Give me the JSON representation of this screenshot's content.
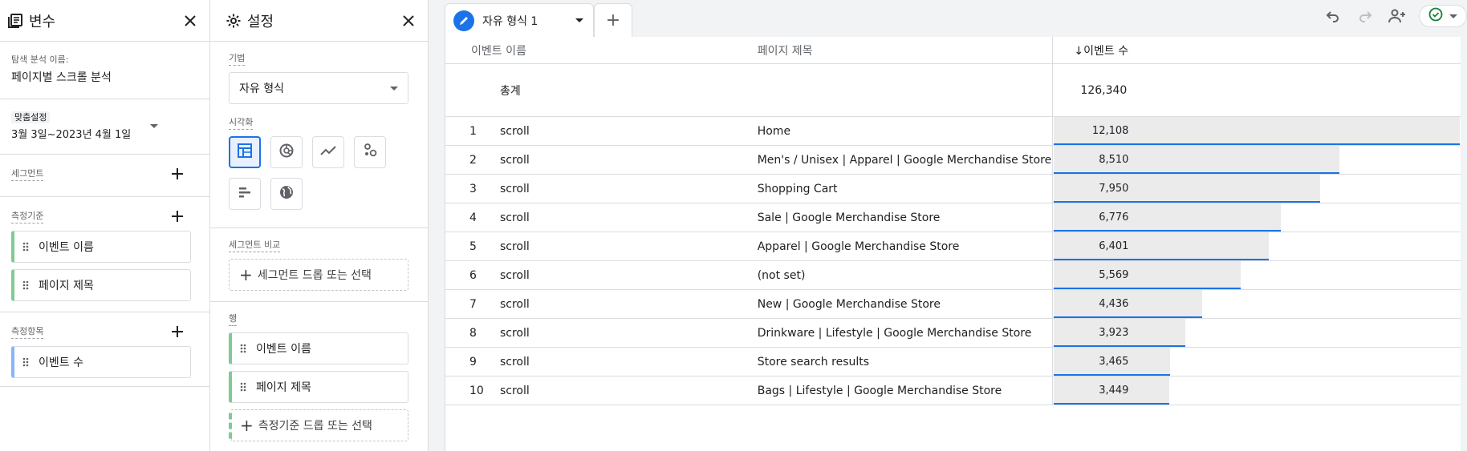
{
  "variables": {
    "title": "변수",
    "exploration_name_label": "탐색 분석 이름:",
    "exploration_name": "페이지별 스크롤 분석",
    "date_tag": "맞춤설정",
    "date_range": "3월 3일~2023년 4월 1일",
    "segments_label": "세그먼트",
    "dimensions_label": "측정기준",
    "dimensions": [
      "이벤트 이름",
      "페이지 제목"
    ],
    "metrics_label": "측정항목",
    "metrics": [
      "이벤트 수"
    ]
  },
  "settings": {
    "title": "설정",
    "technique_label": "기법",
    "technique_value": "자유 형식",
    "visualization_label": "시각화",
    "segment_compare_label": "세그먼트 비교",
    "segment_drop": "세그먼트 드롭 또는 선택",
    "rows_label": "행",
    "rows": [
      "이벤트 이름",
      "페이지 제목"
    ],
    "rows_drop": "측정기준 드롭 또는 선택"
  },
  "main": {
    "tab_label": "자유 형식 1",
    "add_tab": "+",
    "columns": [
      "이벤트 이름",
      "페이지 제목",
      "↓이벤트 수"
    ],
    "total_label": "총계",
    "total_value": "126,340",
    "rows": [
      {
        "n": "1",
        "event": "scroll",
        "page": "Home",
        "value": "12,108",
        "num": 12108
      },
      {
        "n": "2",
        "event": "scroll",
        "page": "Men's / Unisex | Apparel | Google Merchandise Store",
        "value": "8,510",
        "num": 8510
      },
      {
        "n": "3",
        "event": "scroll",
        "page": "Shopping Cart",
        "value": "7,950",
        "num": 7950
      },
      {
        "n": "4",
        "event": "scroll",
        "page": "Sale | Google Merchandise Store",
        "value": "6,776",
        "num": 6776
      },
      {
        "n": "5",
        "event": "scroll",
        "page": "Apparel | Google Merchandise Store",
        "value": "6,401",
        "num": 6401
      },
      {
        "n": "6",
        "event": "scroll",
        "page": "(not set)",
        "value": "5,569",
        "num": 5569
      },
      {
        "n": "7",
        "event": "scroll",
        "page": "New | Google Merchandise Store",
        "value": "4,436",
        "num": 4436
      },
      {
        "n": "8",
        "event": "scroll",
        "page": "Drinkware | Lifestyle | Google Merchandise Store",
        "value": "3,923",
        "num": 3923
      },
      {
        "n": "9",
        "event": "scroll",
        "page": "Store search results",
        "value": "3,465",
        "num": 3465
      },
      {
        "n": "10",
        "event": "scroll",
        "page": "Bags | Lifestyle | Google Merchandise Store",
        "value": "3,449",
        "num": 3449
      }
    ]
  },
  "colors": {
    "accent": "#1a73e8",
    "dimension_chip": "#81c995",
    "metric_chip": "#8ab4f8",
    "status_ok": "#188038"
  }
}
